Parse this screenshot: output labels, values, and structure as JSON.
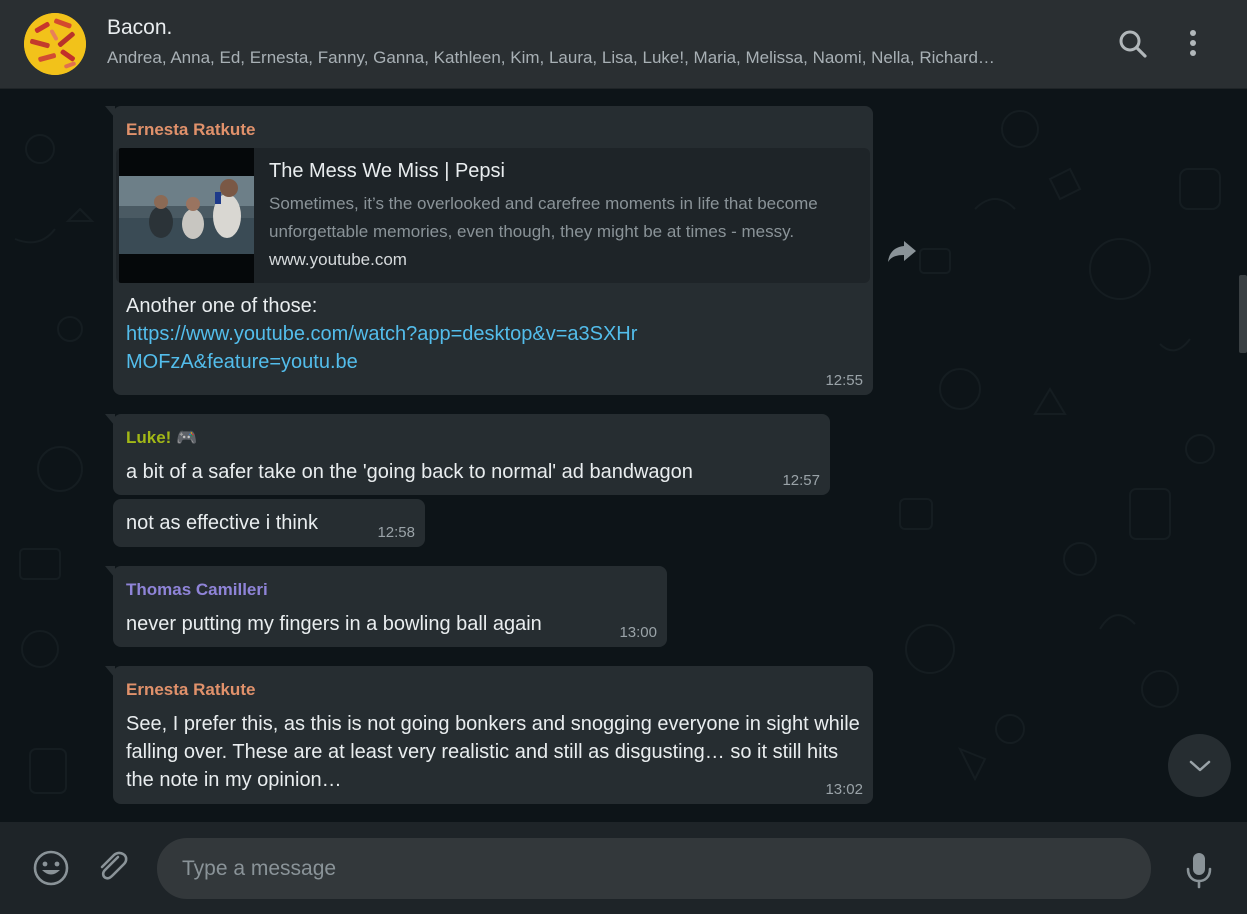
{
  "header": {
    "title": "Bacon.",
    "participants": "Andrea, Anna, Ed, Ernesta, Fanny, Ganna, Kathleen, Kim, Laura, Lisa, Luke!, Maria, Melissa, Naomi, Nella, Richard…"
  },
  "messages": [
    {
      "sender": "Ernesta Ratkute",
      "sender_color": "#e0916b",
      "preview": {
        "title": "The Mess We Miss | Pepsi",
        "description": "Sometimes, it’s the overlooked and carefree moments in life that become unforgettable memories, even though, they might be at times - messy.",
        "domain": "www.youtube.com"
      },
      "text": "Another one of those:",
      "link": "https://www.youtube.com/watch?app=desktop&v=a3SXHrMOFzA&feature=youtu.be",
      "time": "12:55"
    },
    {
      "sender": "Luke!",
      "sender_color": "#a2b816",
      "sender_emoji": "🎮",
      "text": "a bit of a safer take on the 'going back to normal' ad bandwagon",
      "time": "12:57"
    },
    {
      "text": "not as effective i think",
      "time": "12:58"
    },
    {
      "sender": "Thomas Camilleri",
      "sender_color": "#8f84d8",
      "text": "never putting my fingers in a bowling ball again",
      "time": "13:00"
    },
    {
      "sender": "Ernesta Ratkute",
      "sender_color": "#e0916b",
      "text": "See, I prefer this, as this is not going bonkers and snogging everyone in sight while falling over. These are at least very realistic and still as disgusting… so it still hits the note in my opinion…",
      "time": "13:02"
    }
  ],
  "compose": {
    "placeholder": "Type a message"
  },
  "icons": {
    "search": "search-icon",
    "menu": "menu-icon",
    "forward": "forward-icon",
    "scroll_down": "chevron-down-icon",
    "emoji": "emoji-icon",
    "attach": "paperclip-icon",
    "mic": "microphone-icon"
  },
  "colors": {
    "background": "#0d1418",
    "header": "#2a2f32",
    "bubble": "#262d31",
    "link": "#53bdeb"
  }
}
